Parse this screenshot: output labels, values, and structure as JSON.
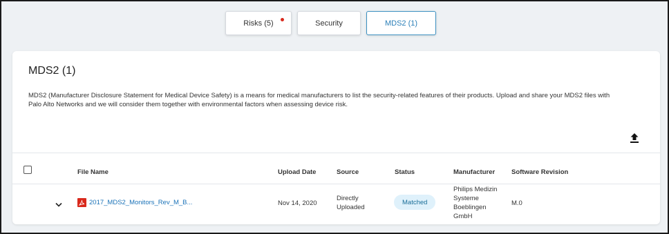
{
  "tabs": [
    {
      "label": "Risks (5)",
      "has_alert_dot": true
    },
    {
      "label": "Security"
    },
    {
      "label": "MDS2 (1)",
      "active": true
    }
  ],
  "card": {
    "title": "MDS2 (1)",
    "description": "MDS2 (Manufacturer Disclosure Statement for Medical Device Safety) is a means for medical manufacturers to list the security-related features of their products. Upload and share your MDS2 files with Palo Alto Networks and we will consider them together with environmental factors when assessing device risk."
  },
  "table": {
    "headers": [
      "File Name",
      "Upload Date",
      "Source",
      "Status",
      "Manufacturer",
      "Software Revision"
    ],
    "rows": [
      {
        "file_name": "2017_MDS2_Monitors_Rev_M_B...",
        "upload_date": "Nov 14, 2020",
        "source_line1": "Directly",
        "source_line2": "Uploaded",
        "status": "Matched",
        "manufacturer_line1": "Philips Medizin",
        "manufacturer_line2": "Systeme",
        "manufacturer_line3": "Boeblingen",
        "manufacturer_line4": "GmbH",
        "software_revision": "M.0"
      }
    ]
  },
  "colors": {
    "accent": "#2b7fb8",
    "alert_dot": "#d9291c",
    "status_bg": "#dff1fb",
    "pdf_icon": "#d9291c"
  },
  "icons": {
    "upload": "upload-icon",
    "expand": "chevron-down-icon",
    "file_type": "pdf-icon"
  }
}
